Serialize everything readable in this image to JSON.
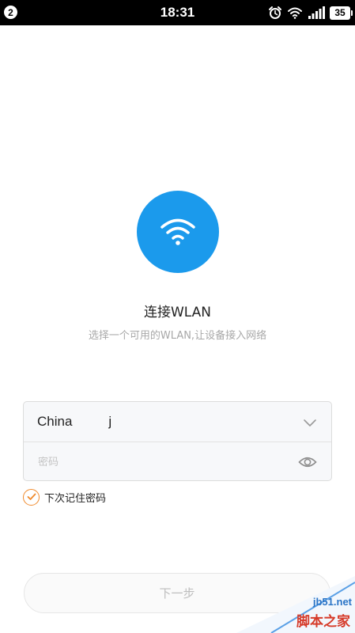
{
  "status_bar": {
    "notification_count": "2",
    "time": "18:31",
    "icons": [
      "alarm-icon",
      "wifi-icon",
      "signal-icon"
    ],
    "battery": "35"
  },
  "hero": {
    "icon": "wifi-icon",
    "icon_color": "#1b9aec",
    "title": "连接WLAN",
    "subtitle": "选择一个可用的WLAN,让设备接入网络"
  },
  "form": {
    "ssid_prefix": "China",
    "ssid_suffix": "j",
    "dropdown_icon": "chevron-down-icon",
    "password_placeholder": "密码",
    "password_value": "",
    "toggle_visibility_icon": "eye-icon",
    "remember": {
      "checked": true,
      "label": "下次记住密码",
      "accent": "#f08a2c"
    }
  },
  "next_button": {
    "label": "下一步",
    "enabled": false
  },
  "watermark": {
    "url": "jb51.net",
    "text": "脚本之家"
  }
}
